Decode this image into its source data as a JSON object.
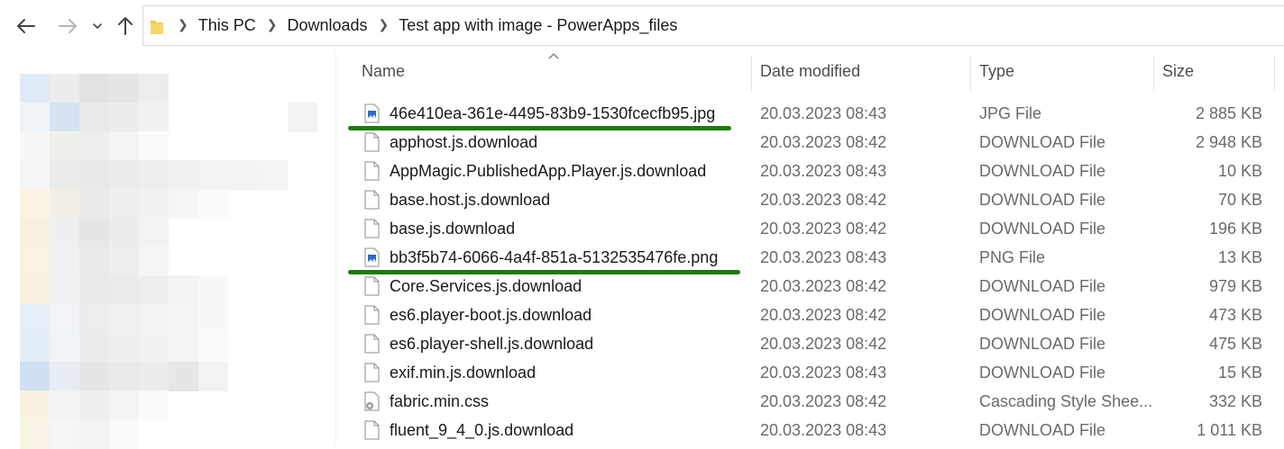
{
  "nav": {
    "back_icon": "arrow-left-icon",
    "forward_icon": "arrow-right-icon",
    "recent_icon": "chevron-down-icon",
    "up_icon": "arrow-up-icon"
  },
  "address": {
    "folder_icon": "folder-icon",
    "crumbs": [
      "This PC",
      "Downloads",
      "Test app with image - PowerApps_files"
    ]
  },
  "columns": {
    "name": "Name",
    "date": "Date modified",
    "type": "Type",
    "size": "Size"
  },
  "files": [
    {
      "name": "46e410ea-361e-4495-83b9-1530fcecfb95.jpg",
      "date": "20.03.2023 08:43",
      "type": "JPG File",
      "size": "2 885 KB",
      "icon": "image-file-icon",
      "highlighted": true
    },
    {
      "name": "apphost.js.download",
      "date": "20.03.2023 08:42",
      "type": "DOWNLOAD File",
      "size": "2 948 KB",
      "icon": "file-icon",
      "highlighted": false
    },
    {
      "name": "AppMagic.PublishedApp.Player.js.download",
      "date": "20.03.2023 08:43",
      "type": "DOWNLOAD File",
      "size": "10 KB",
      "icon": "file-icon",
      "highlighted": false
    },
    {
      "name": "base.host.js.download",
      "date": "20.03.2023 08:42",
      "type": "DOWNLOAD File",
      "size": "70 KB",
      "icon": "file-icon",
      "highlighted": false
    },
    {
      "name": "base.js.download",
      "date": "20.03.2023 08:42",
      "type": "DOWNLOAD File",
      "size": "196 KB",
      "icon": "file-icon",
      "highlighted": false
    },
    {
      "name": "bb3f5b74-6066-4a4f-851a-5132535476fe.png",
      "date": "20.03.2023 08:43",
      "type": "PNG File",
      "size": "13 KB",
      "icon": "image-file-icon",
      "highlighted": true
    },
    {
      "name": "Core.Services.js.download",
      "date": "20.03.2023 08:42",
      "type": "DOWNLOAD File",
      "size": "979 KB",
      "icon": "file-icon",
      "highlighted": false
    },
    {
      "name": "es6.player-boot.js.download",
      "date": "20.03.2023 08:42",
      "type": "DOWNLOAD File",
      "size": "473 KB",
      "icon": "file-icon",
      "highlighted": false
    },
    {
      "name": "es6.player-shell.js.download",
      "date": "20.03.2023 08:42",
      "type": "DOWNLOAD File",
      "size": "475 KB",
      "icon": "file-icon",
      "highlighted": false
    },
    {
      "name": "exif.min.js.download",
      "date": "20.03.2023 08:43",
      "type": "DOWNLOAD File",
      "size": "15 KB",
      "icon": "file-icon",
      "highlighted": false
    },
    {
      "name": "fabric.min.css",
      "date": "20.03.2023 08:42",
      "type": "Cascading Style Shee...",
      "size": "332 KB",
      "icon": "css-file-icon",
      "highlighted": false
    },
    {
      "name": "fluent_9_4_0.js.download",
      "date": "20.03.2023 08:43",
      "type": "DOWNLOAD File",
      "size": "1 011 KB",
      "icon": "file-icon",
      "highlighted": false
    }
  ],
  "colors": {
    "highlight_underline": "#1e7a0a",
    "image_icon_blue": "#2b6cc4"
  }
}
